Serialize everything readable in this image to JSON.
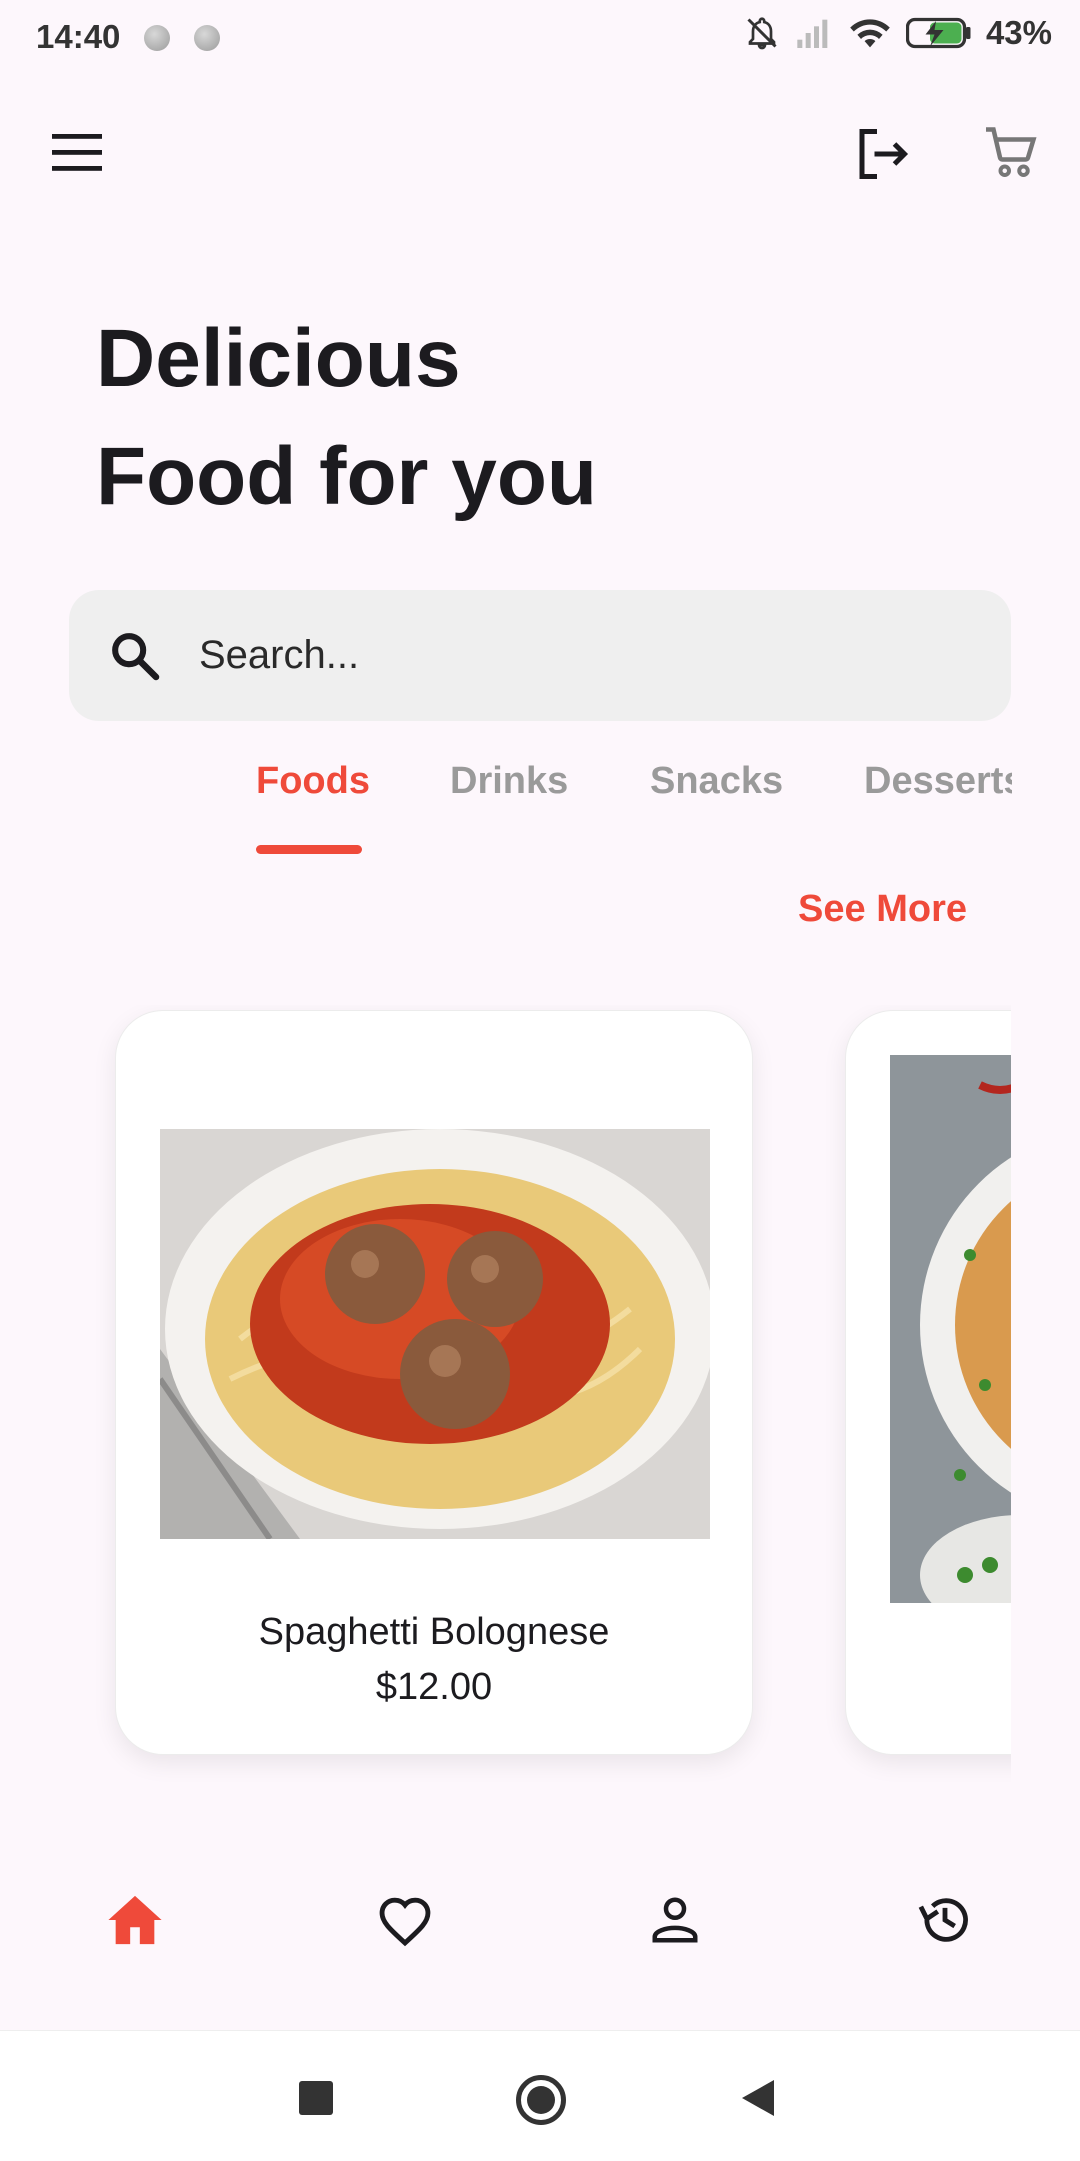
{
  "status_bar": {
    "time": "14:40",
    "battery": "43%",
    "icons": [
      "notification-dot-icon",
      "notification-dot-icon",
      "bell-off-icon",
      "signal-icon",
      "wifi-icon",
      "battery-charging-icon"
    ]
  },
  "app_bar": {
    "menu_icon": "menu-icon",
    "logout_icon": "logout-icon",
    "cart_icon": "cart-icon"
  },
  "headline": {
    "line1": "Delicious",
    "line2": "Food for you"
  },
  "search": {
    "placeholder": "Search...",
    "icon": "search-icon"
  },
  "tabs": [
    {
      "label": "Foods",
      "active": true
    },
    {
      "label": "Drinks",
      "active": false
    },
    {
      "label": "Snacks",
      "active": false
    },
    {
      "label": "Desserts",
      "active": false
    }
  ],
  "see_more": "See More",
  "products": [
    {
      "name": "Spaghetti Bolognese",
      "price": "$12.00",
      "image": "spaghetti-bolognese-image"
    },
    {
      "name": "",
      "price": "",
      "image": "fried-rice-image"
    }
  ],
  "bottom_nav": [
    {
      "icon": "home-icon",
      "active": true
    },
    {
      "icon": "heart-icon",
      "active": false
    },
    {
      "icon": "profile-icon",
      "active": false
    },
    {
      "icon": "history-icon",
      "active": false
    }
  ],
  "colors": {
    "accent": "#ef4a3a",
    "background": "#fdf7fc",
    "search_bg": "#efefef",
    "inactive_tab": "#9a9a9a"
  }
}
